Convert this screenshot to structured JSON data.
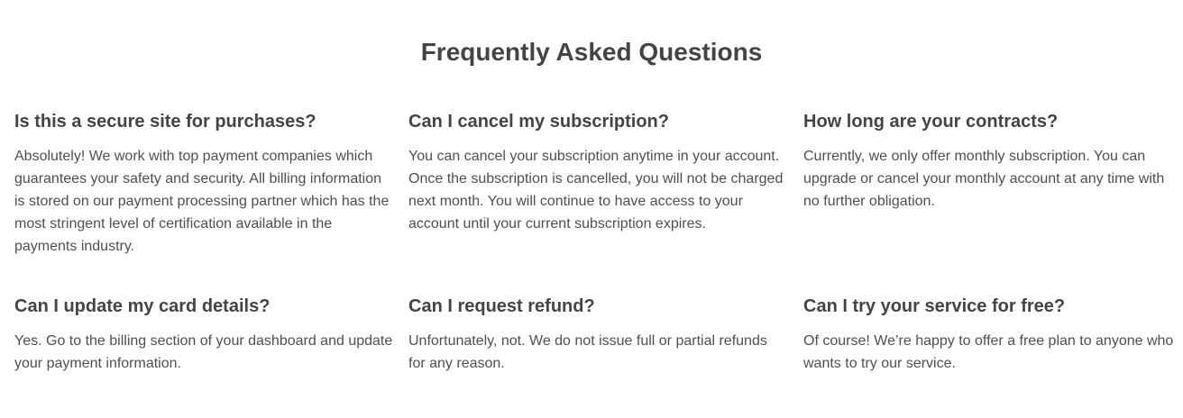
{
  "faq": {
    "title": "Frequently Asked Questions",
    "items": [
      {
        "question": "Is this a secure site for purchases?",
        "answer": "Absolutely! We work with top payment companies which guarantees your safety and security. All billing information is stored on our payment processing partner which has the most stringent level of certification available in the payments industry."
      },
      {
        "question": "Can I cancel my subscription?",
        "answer": "You can cancel your subscription anytime in your account. Once the subscription is cancelled, you will not be charged next month. You will continue to have access to your account until your current subscription expires."
      },
      {
        "question": "How long are your contracts?",
        "answer": "Currently, we only offer monthly subscription. You can upgrade or cancel your monthly account at any time with no further obligation."
      },
      {
        "question": "Can I update my card details?",
        "answer": "Yes. Go to the billing section of your dashboard and update your payment information."
      },
      {
        "question": "Can I request refund?",
        "answer": "Unfortunately, not. We do not issue full or partial refunds for any reason."
      },
      {
        "question": "Can I try your service for free?",
        "answer": "Of course! We’re happy to offer a free plan to anyone who wants to try our service."
      }
    ]
  }
}
